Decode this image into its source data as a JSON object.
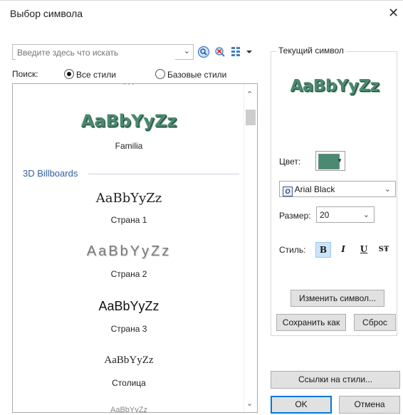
{
  "window": {
    "title": "Выбор символа",
    "close_glyph": "✕"
  },
  "search": {
    "placeholder": "Введите здесь что искать",
    "value": ""
  },
  "filter": {
    "label": "Поиск:",
    "options": [
      "Все стили",
      "Базовые стили"
    ],
    "selected": "Все стили"
  },
  "symbol_list": {
    "top_caption_partial": "+++",
    "items": [
      {
        "sample": "AaBbYyZz",
        "caption": "Familia"
      },
      {
        "sample": "AaBbYyZz",
        "caption": "Страна 1"
      },
      {
        "sample": "AaBbYyZz",
        "caption": "Страна 2"
      },
      {
        "sample": "AaBbYyZz",
        "caption": "Страна 3"
      },
      {
        "sample": "AaBbYyZz",
        "caption": "Столица"
      }
    ],
    "group_label": "3D Billboards",
    "bottom_partial": "AaBbYyZz"
  },
  "current_symbol": {
    "group_title": "Текущий символ",
    "sample": "AaBbYyZz",
    "color_label": "Цвет:",
    "color": "#4a8a70",
    "font_value": "Arial Black",
    "size_label": "Размер:",
    "size_value": "20",
    "style_label": "Стиль:",
    "style_buttons": {
      "bold": "B",
      "italic": "I",
      "underline": "U",
      "strike": "SŦ"
    },
    "bold_active": true
  },
  "buttons": {
    "edit_symbol": "Изменить символ...",
    "save_as": "Сохранить как",
    "reset": "Сброс",
    "style_refs": "Ссылки на стили...",
    "ok": "OK",
    "cancel": "Отмена"
  }
}
